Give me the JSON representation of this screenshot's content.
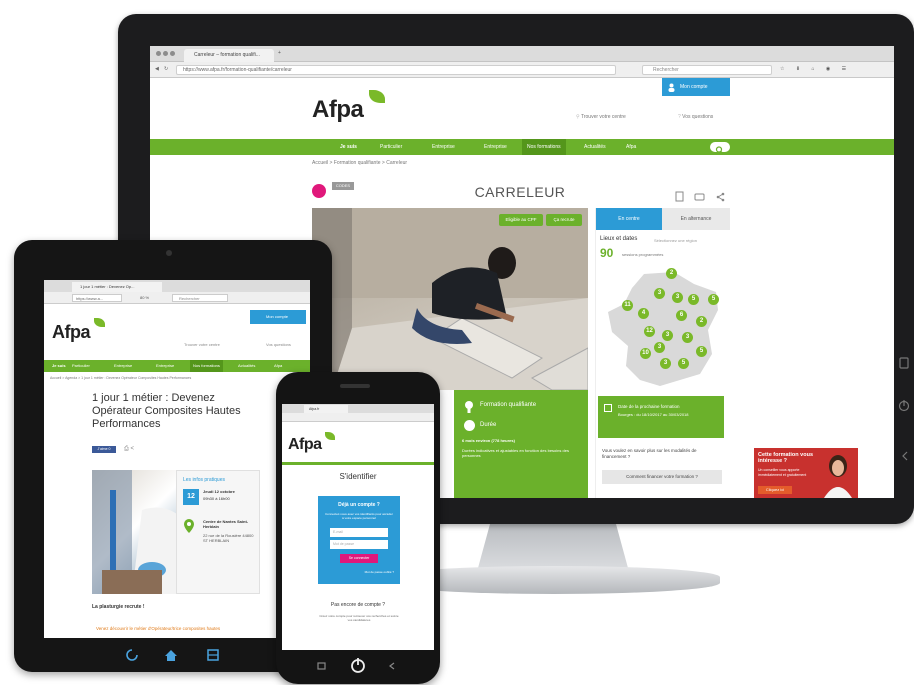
{
  "brand": {
    "logo": "Afpa",
    "green": "#6bb12b",
    "blue": "#2c9bd6",
    "magenta": "#e0187b"
  },
  "desktop": {
    "tab_title": "Carreleur – formation qualifi...",
    "url": "https://www.afpa.fr/formation-qualifiante/carreleur",
    "search_placeholder": "Rechercher",
    "mon_compte": "Mon compte",
    "trouver_centre": "Trouver votre centre",
    "vos_questions": "Vos questions",
    "nav": [
      "Je suis",
      "Particulier",
      "Entreprise",
      "Entreprise",
      "Nos formations",
      "Actualités",
      "Afpa"
    ],
    "breadcrumb": "Accueil  >  Formation qualifiante  >  Carreleur",
    "badge_code": "CODES",
    "page_title": "CARRELEUR",
    "eligible_cpf": "Eligible au CPF",
    "ca_recrute": "Ça recrute",
    "tab_en_centre": "En centre",
    "tab_en_alternance": "En alternance",
    "lieux_dates": "Lieux et dates",
    "lieux_hint": "Sélectionnez une région",
    "sessions_count": "90",
    "sessions_label": "sessions programmées",
    "formation_qualifiante": "Formation qualifiante",
    "duree": "Durée",
    "duree_value": "6 mois environ (778 heures)",
    "duree_note": "Durées indicatives et ajustables en fonction des besoins des personnes",
    "prochaine_formation": "Date de la prochaine formation",
    "prochaine_detail": "Bourges : du 18/10/2017 au 30/03/2018",
    "financement_q": "Vous voulez en savoir plus sur les modalités de financement ?",
    "financement_btn": "Comment financer votre formation ?",
    "map_numbers": [
      "2",
      "5",
      "3",
      "3",
      "5",
      "11",
      "4",
      "6",
      "2",
      "12",
      "3",
      "3",
      "3",
      "10",
      "5",
      "3",
      "5"
    ],
    "promo_title": "Cette formation vous intéresse ?",
    "promo_text": "Un conseiller vous apporte immédiatement et gratuitement",
    "promo_btn": "Cliquez ici"
  },
  "tablet": {
    "tab_title": "1 jour 1 métier : Devenez Op...",
    "url": "https://www.a...",
    "zoom": "80 %",
    "search_placeholder": "Rechercher",
    "mon_compte": "Mon compte",
    "trouver_centre": "Trouver votre centre",
    "vos_questions": "Vos questions",
    "nav": [
      "Je suis",
      "Particulier",
      "Entreprise",
      "Entreprise",
      "Nos formations",
      "Actualités",
      "Afpa"
    ],
    "breadcrumb": "Accueil  >  Agenda  >  1 jour 1 métier : Devenez Opérateur Composites Hautes Performances",
    "title": "1 jour 1 métier : Devenez Opérateur Composites Hautes Performances",
    "share_label": "J'aime 0",
    "infos_title": "Les infos pratiques",
    "date_day": "12",
    "date_text": "Jeudi 12 octobre",
    "time_text": "09h30 à 16h00",
    "lieu_title": "Centre de Nantes Saint-Herblain",
    "lieu_addr": "22 rue de la Rousière 44800 ST HERBLAIN",
    "intro": "La plasturgie recrute !",
    "link_text": "Venez découvrir le métier d'Opérateur/trice composites hautes"
  },
  "phone": {
    "tab_title": "Afpa.fr",
    "heading": "S'identifier",
    "already": "Déjà un compte ?",
    "login_hint": "Connectez-vous avec vos identifiants pour accéder à votre espace personnel",
    "email_placeholder": "E-mail",
    "password_placeholder": "Mot de passe",
    "connect_btn": "Se connecter",
    "forgot": "Mot de passe oublié ?",
    "not_yet": "Pas encore de compte ?",
    "create_text": "Créez votre compte pour retrouver vos recherches et suivre vos candidatures"
  }
}
